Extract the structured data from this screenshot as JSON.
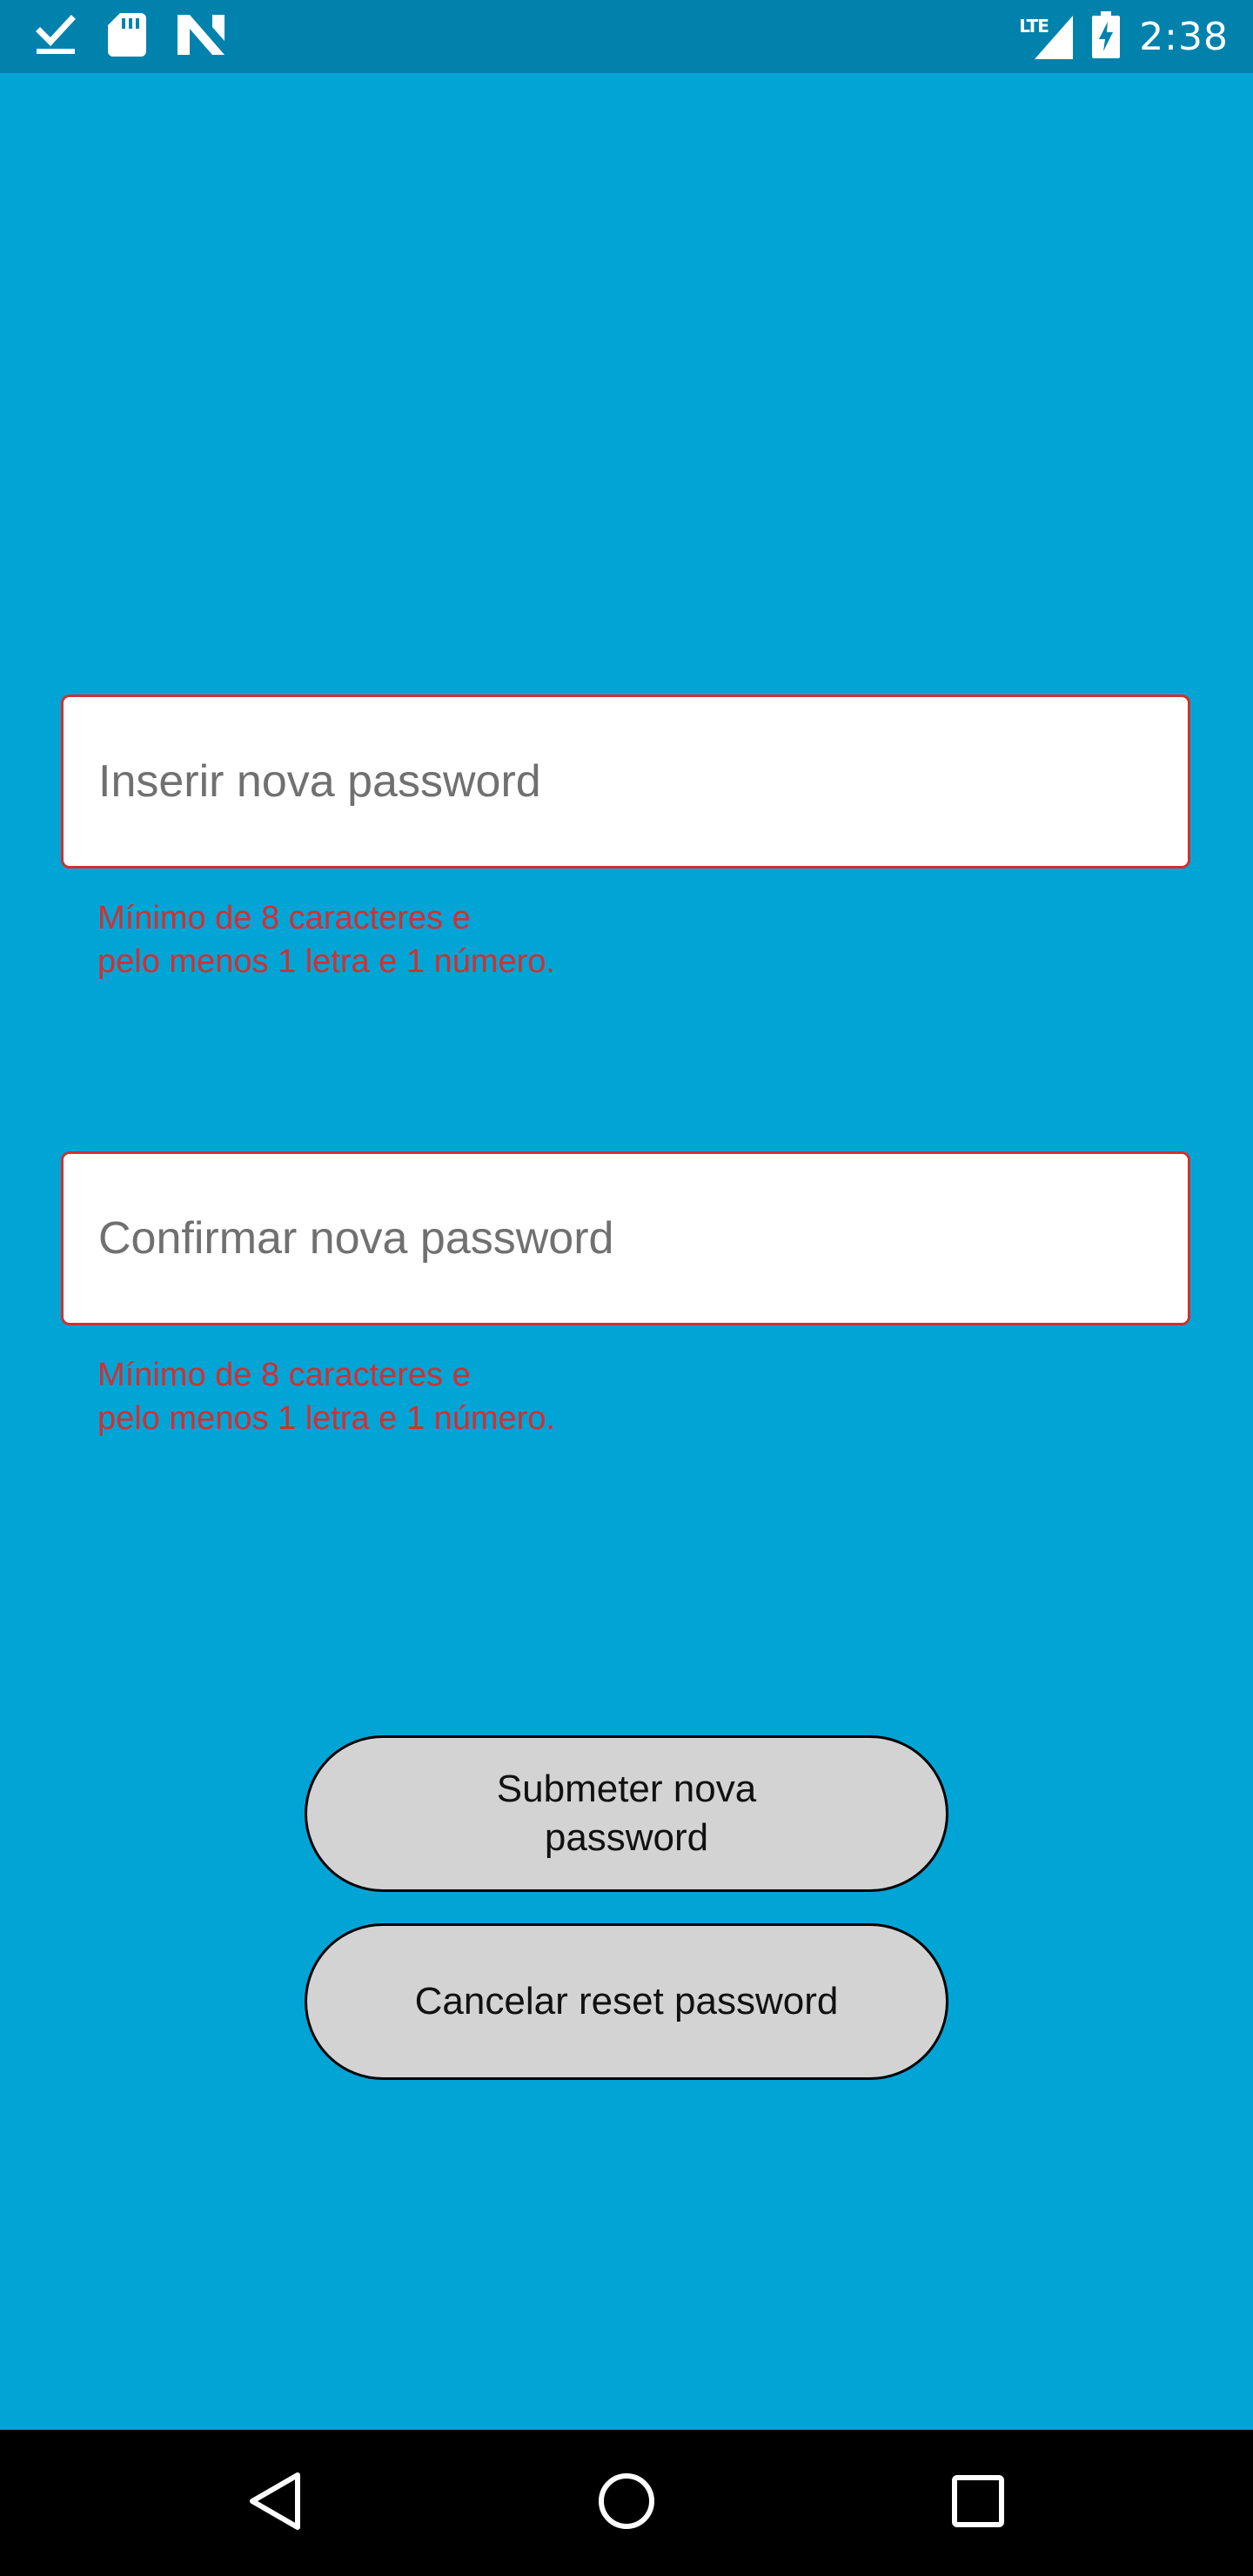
{
  "status_bar": {
    "time": "2:38",
    "network": "LTE",
    "icons": [
      "download-done-icon",
      "sd-card-icon",
      "n-logo-icon",
      "signal-icon",
      "battery-charging-icon"
    ]
  },
  "form": {
    "new_password": {
      "placeholder": "Inserir nova password",
      "value": "",
      "error_line1": "Mínimo de 8 caracteres e",
      "error_line2": "pelo menos 1 letra e 1 número."
    },
    "confirm_password": {
      "placeholder": "Confirmar nova password",
      "value": "",
      "error_line1": "Mínimo de 8 caracteres e",
      "error_line2": "pelo menos 1 letra e 1 número."
    }
  },
  "buttons": {
    "submit_label": "Submeter nova password",
    "cancel_label": "Cancelar reset password"
  },
  "nav_bar": {
    "icons": [
      "back-icon",
      "home-icon",
      "recents-icon"
    ]
  },
  "colors": {
    "background": "#00A5D6",
    "status_bar": "#0182AC",
    "error": "#D32F2F",
    "button": "#D3D3D3"
  }
}
